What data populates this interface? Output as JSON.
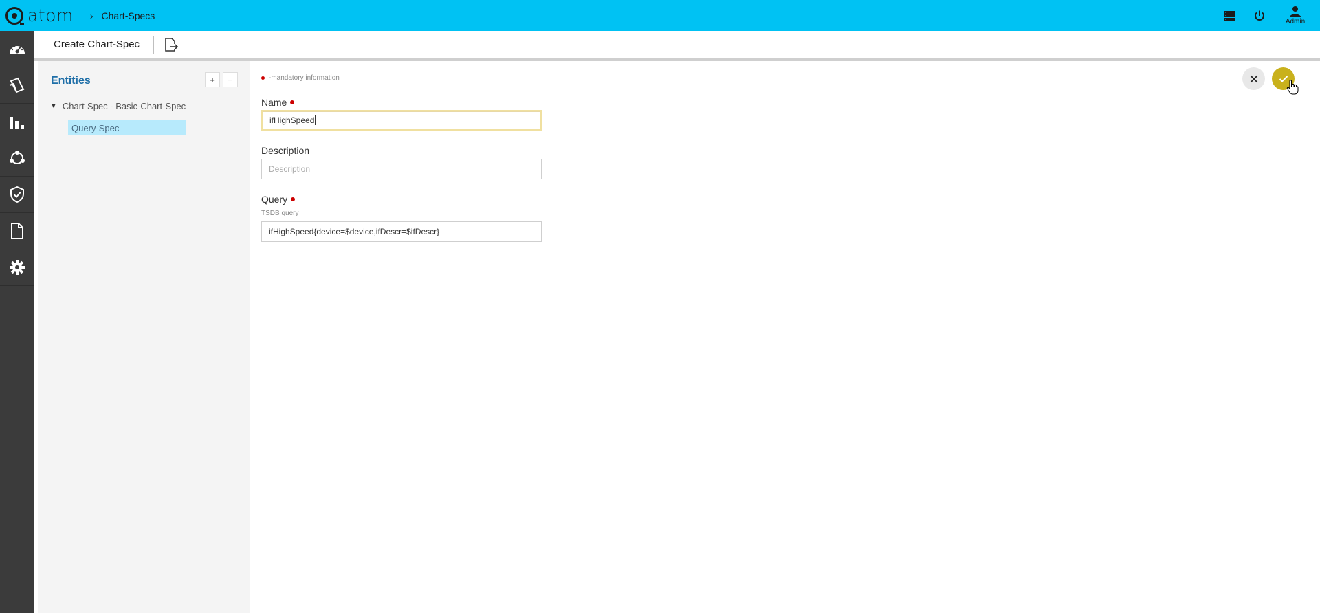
{
  "topbar": {
    "logo_text": "atom",
    "breadcrumb_separator": "›",
    "breadcrumb": "Chart-Specs",
    "admin_label": "Admin",
    "color": "#00c2f3"
  },
  "sidenav": {
    "items": [
      {
        "icon": "dashboard-icon"
      },
      {
        "icon": "inventory-icon"
      },
      {
        "icon": "bar-chart-icon"
      },
      {
        "icon": "topology-icon"
      },
      {
        "icon": "shield-icon"
      },
      {
        "icon": "document-icon"
      },
      {
        "icon": "gear-icon"
      }
    ]
  },
  "subbar": {
    "title": "Create Chart-Spec",
    "export_icon": "export-file-icon"
  },
  "entities": {
    "title": "Entities",
    "add_label": "+",
    "remove_label": "−",
    "tree_root": "Chart-Spec - Basic-Chart-Spec",
    "tree_child": "Query-Spec"
  },
  "form": {
    "mandatory_note": "-mandatory information",
    "name": {
      "label": "Name",
      "value": "ifHighSpeed"
    },
    "description": {
      "label": "Description",
      "placeholder": "Description"
    },
    "query": {
      "label": "Query",
      "hint": "TSDB query",
      "value": "ifHighSpeed{device=$device,ifDescr=$ifDescr}"
    }
  },
  "colors": {
    "accent": "#00c2f3",
    "ok_button": "#c9b11c",
    "mandatory_dot": "#cc0000",
    "title_blue": "#1f6fa8"
  }
}
